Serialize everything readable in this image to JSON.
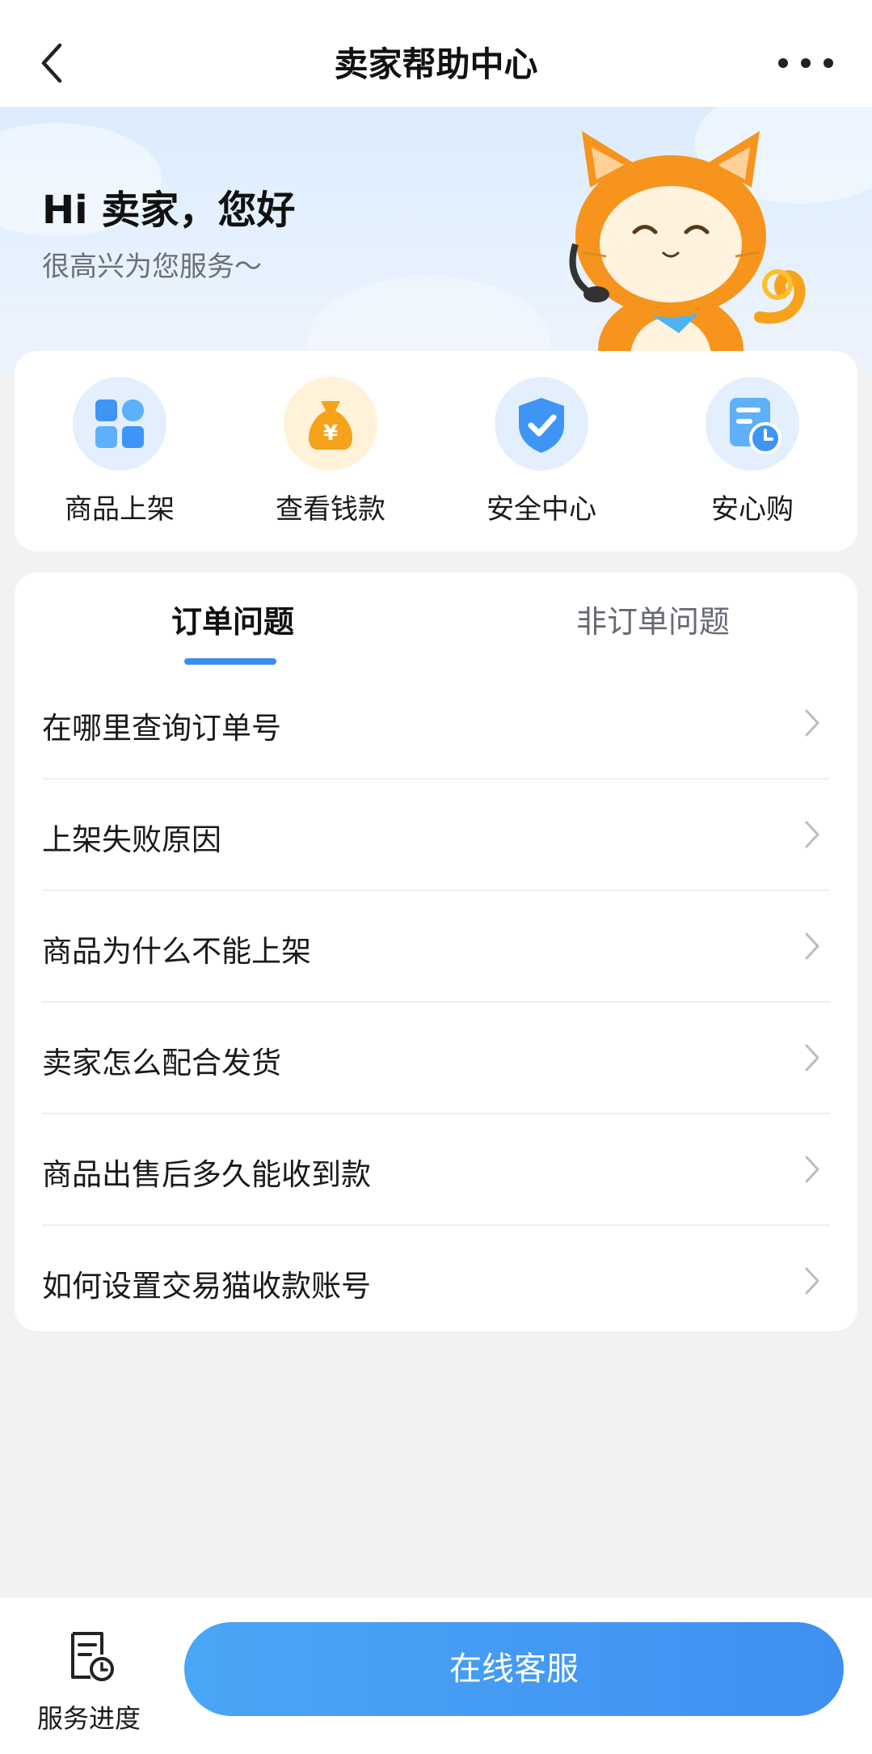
{
  "nav": {
    "title": "卖家帮助中心"
  },
  "hero": {
    "greeting": "Hi 卖家，您好",
    "subtitle": "很高兴为您服务～"
  },
  "quick_actions": [
    {
      "label": "商品上架",
      "icon": "apps-grid-icon",
      "color": "#3f95f5"
    },
    {
      "label": "查看钱款",
      "icon": "money-bag-icon",
      "color": "#f7a21b"
    },
    {
      "label": "安全中心",
      "icon": "shield-check-icon",
      "color": "#3f95f5"
    },
    {
      "label": "安心购",
      "icon": "order-clock-icon",
      "color": "#3f95f5"
    }
  ],
  "tabs": {
    "active": "订单问题",
    "inactive": "非订单问题"
  },
  "faq": [
    {
      "question": "在哪里查询订单号"
    },
    {
      "question": "上架失败原因"
    },
    {
      "question": "商品为什么不能上架"
    },
    {
      "question": "卖家怎么配合发货"
    },
    {
      "question": "商品出售后多久能收到款"
    },
    {
      "question": "如何设置交易猫收款账号"
    }
  ],
  "bottom": {
    "progress_label": "服务进度",
    "cs_label": "在线客服"
  },
  "colors": {
    "accent": "#3f8ff0",
    "mascot_orange": "#f7941d"
  }
}
